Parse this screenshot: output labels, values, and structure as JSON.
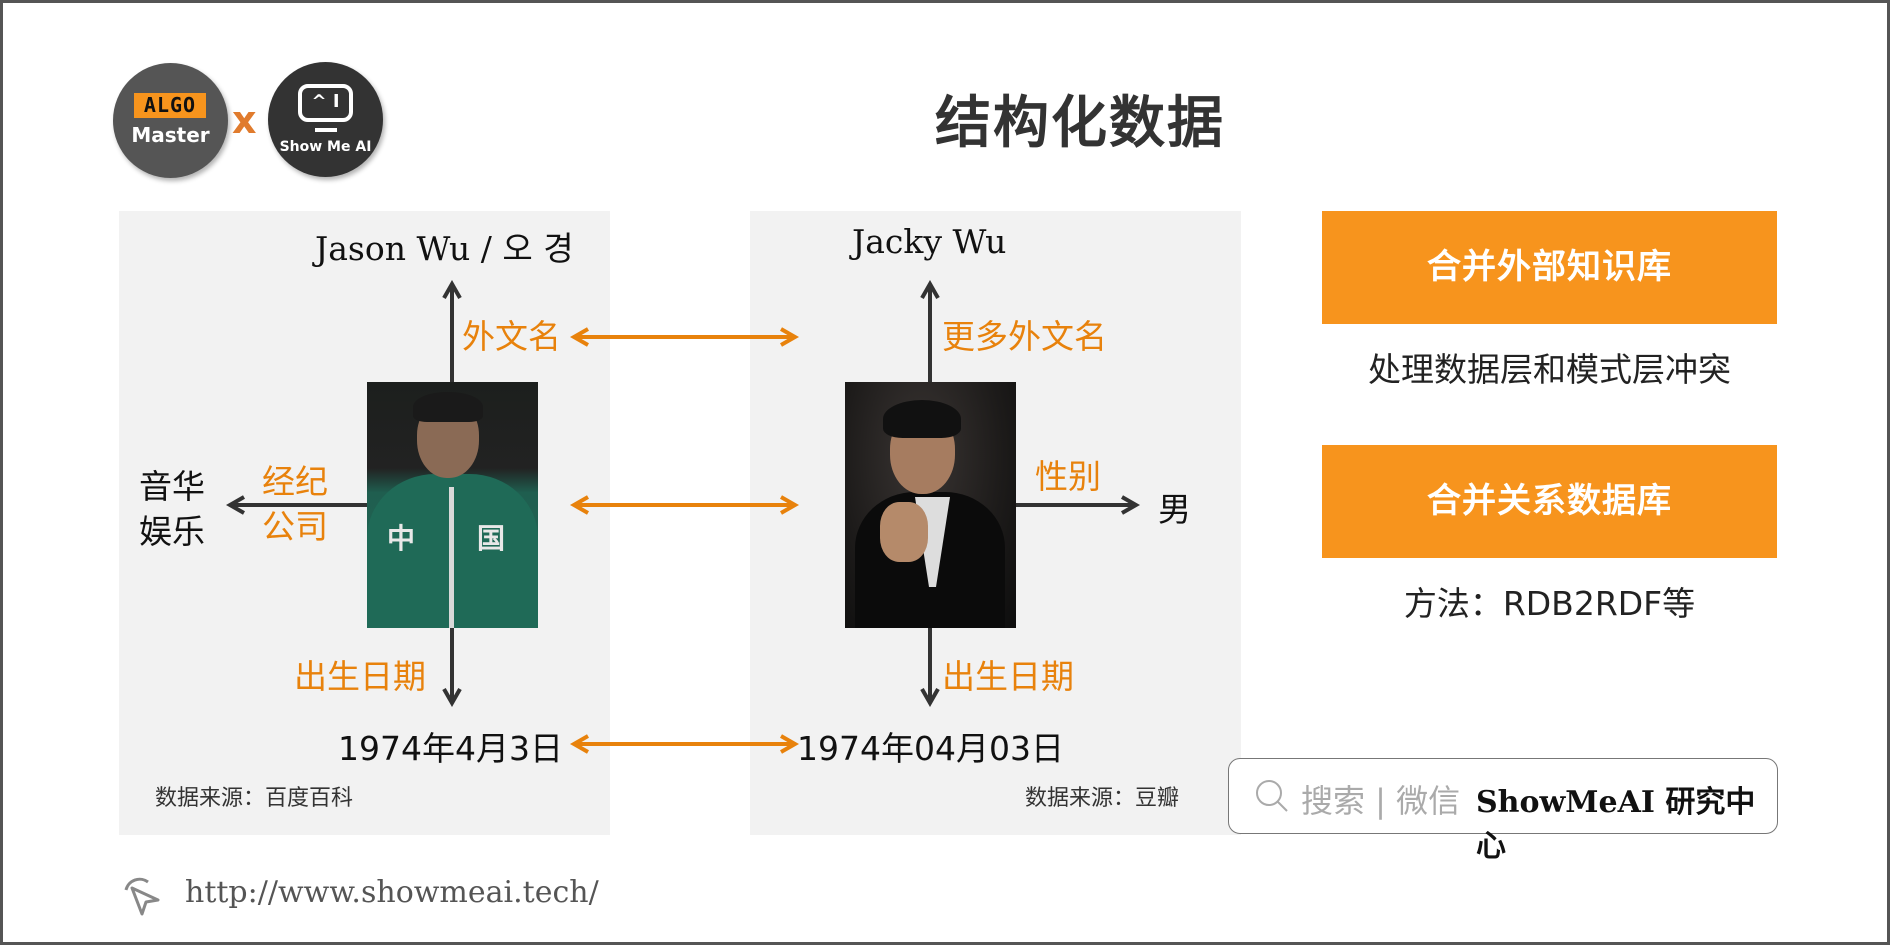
{
  "header": {
    "title": "结构化数据",
    "logos": {
      "algo_tag": "ALGO",
      "algo_name": "Master",
      "separator": "x",
      "showmeai_screen": "^ I",
      "showmeai_name": "Show Me AI"
    }
  },
  "colors": {
    "accent_orange": "#F7941D",
    "relation_orange": "#E8820C",
    "panel_bg": "#f2f2f2",
    "arrow_dark": "#333333"
  },
  "left_entity": {
    "photo_alt": "Wu Jing in green jacket",
    "jacket_chars": [
      "中",
      "国"
    ],
    "foreign_name_value": "Jason Wu / 오 경",
    "foreign_name_relation": "外文名",
    "agency_relation_line1": "经纪",
    "agency_relation_line2": "公司",
    "agency_value_line1": "音华",
    "agency_value_line2": "娱乐",
    "birth_relation": "出生日期",
    "birth_value": "1974年4月3日",
    "source": "数据来源：百度百科"
  },
  "mid_entity": {
    "photo_alt": "Wu Jing in tuxedo",
    "foreign_name_value": "Jacky Wu",
    "foreign_name_relation": "更多外文名",
    "gender_relation": "性别",
    "gender_value": "男",
    "birth_relation": "出生日期",
    "birth_value": "1974年04月03日",
    "source": "数据来源：豆瓣"
  },
  "cards": [
    {
      "title": "合并外部知识库",
      "description": "处理数据层和模式层冲突"
    },
    {
      "title": "合并关系数据库",
      "description": "方法：RDB2RDF等"
    }
  ],
  "search": {
    "icon": "search-icon",
    "prompt": "搜索 | 微信",
    "brand": "ShowMeAI 研究中心"
  },
  "footer": {
    "icon": "cursor-click-icon",
    "url": "http://www.showmeai.tech/"
  }
}
